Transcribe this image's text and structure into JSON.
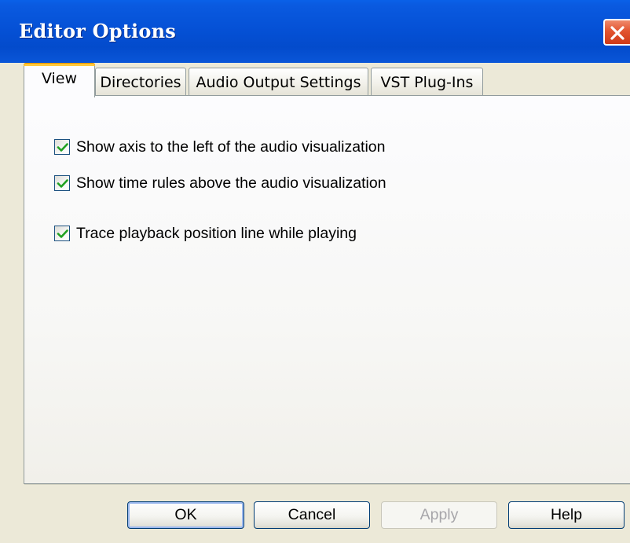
{
  "window": {
    "title": "Editor Options",
    "close_icon": "close-x-icon"
  },
  "tabs": [
    {
      "label": "View",
      "active": true
    },
    {
      "label": "Directories",
      "active": false
    },
    {
      "label": "Audio Output Settings",
      "active": false
    },
    {
      "label": "VST Plug-Ins",
      "active": false
    }
  ],
  "view": {
    "options": [
      {
        "label": "Show axis to the left of the audio visualization",
        "checked": true
      },
      {
        "label": "Show time rules above the audio visualization",
        "checked": true
      },
      {
        "label": "Trace playback position line while playing",
        "checked": true
      }
    ]
  },
  "buttons": {
    "ok": "OK",
    "cancel": "Cancel",
    "apply": "Apply",
    "help": "Help"
  },
  "colors": {
    "titlebar": "#0551d6",
    "active_tab_highlight": "#ffc83c",
    "checkmark": "#21a121",
    "close_button": "#e2542f"
  }
}
